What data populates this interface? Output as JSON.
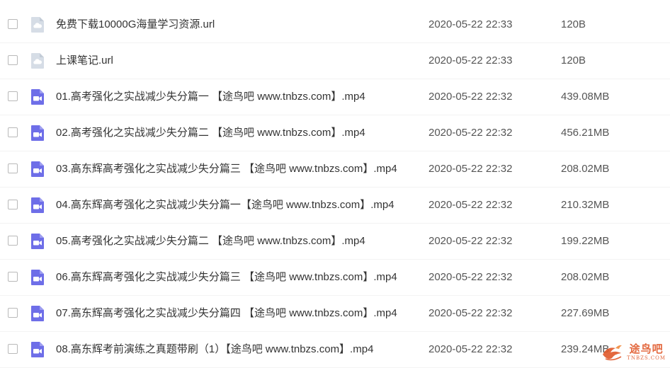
{
  "files": [
    {
      "name": "免费下载10000G海量学习资源.url",
      "date": "2020-05-22 22:33",
      "size": "120B",
      "type": "url",
      "icon": "cloud-link-icon"
    },
    {
      "name": "上课笔记.url",
      "date": "2020-05-22 22:33",
      "size": "120B",
      "type": "url",
      "icon": "cloud-link-icon"
    },
    {
      "name": "01.高考强化之实战减少失分篇一 【途鸟吧 www.tnbzs.com】.mp4",
      "date": "2020-05-22 22:32",
      "size": "439.08MB",
      "type": "video",
      "icon": "video-file-icon"
    },
    {
      "name": "02.高考强化之实战减少失分篇二 【途鸟吧 www.tnbzs.com】.mp4",
      "date": "2020-05-22 22:32",
      "size": "456.21MB",
      "type": "video",
      "icon": "video-file-icon"
    },
    {
      "name": "03.高东辉高考强化之实战减少失分篇三 【途鸟吧 www.tnbzs.com】.mp4",
      "date": "2020-05-22 22:32",
      "size": "208.02MB",
      "type": "video",
      "icon": "video-file-icon"
    },
    {
      "name": "04.高东辉高考强化之实战减少失分篇一【途鸟吧 www.tnbzs.com】.mp4",
      "date": "2020-05-22 22:32",
      "size": "210.32MB",
      "type": "video",
      "icon": "video-file-icon"
    },
    {
      "name": "05.高考强化之实战减少失分篇二 【途鸟吧 www.tnbzs.com】.mp4",
      "date": "2020-05-22 22:32",
      "size": "199.22MB",
      "type": "video",
      "icon": "video-file-icon"
    },
    {
      "name": "06.高东辉高考强化之实战减少失分篇三 【途鸟吧 www.tnbzs.com】.mp4",
      "date": "2020-05-22 22:32",
      "size": "208.02MB",
      "type": "video",
      "icon": "video-file-icon"
    },
    {
      "name": "07.高东辉高考强化之实战减少失分篇四 【途鸟吧 www.tnbzs.com】.mp4",
      "date": "2020-05-22 22:32",
      "size": "227.69MB",
      "type": "video",
      "icon": "video-file-icon"
    },
    {
      "name": "08.高东辉考前演练之真题带刷（1）【途鸟吧 www.tnbzs.com】.mp4",
      "date": "2020-05-22 22:32",
      "size": "239.24MB",
      "type": "video",
      "icon": "video-file-icon"
    }
  ],
  "watermark": {
    "cn": "途鸟吧",
    "en": "TNBZS.COM",
    "icon": "bird-logo-icon"
  },
  "colors": {
    "url_icon": "#d6dde6",
    "video_icon": "#6e6ee8",
    "watermark": "#e0582a"
  }
}
